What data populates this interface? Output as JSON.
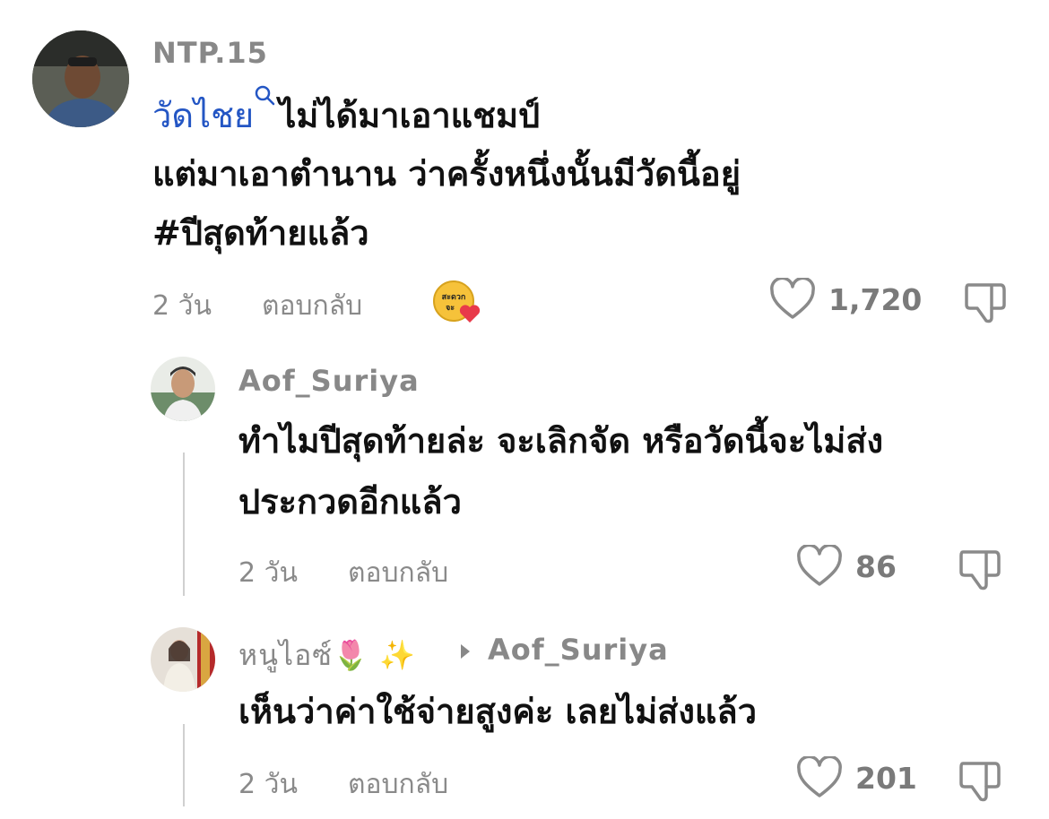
{
  "comments": [
    {
      "username": "NTP.15",
      "link_text": "วัดไชย",
      "line1_rest": "ไม่ได้มาเอาแชมป์",
      "line2": "แต่มาเอาตำนาน ว่าครั้งหนึ่งนั้นมีวัดนี้อยู่",
      "line3": "#ปีสุดท้ายแล้ว",
      "time": "2 วัน",
      "reply_label": "ตอบกลับ",
      "likes": "1,720"
    },
    {
      "username": "Aof_Suriya",
      "line1": "ทำไมปีสุดท้ายล่ะ จะเลิกจัด หรือวัดนี้จะไม่ส่ง",
      "line2": "ประกวดอีกแล้ว",
      "time": "2 วัน",
      "reply_label": "ตอบกลับ",
      "likes": "86"
    },
    {
      "username": "หนูไอซ์🌷 ✨",
      "reply_to": "Aof_Suriya",
      "line1": "เห็นว่าค่าใช้จ่ายสูงค่ะ เลยไม่ส่งแล้ว",
      "time": "2 วัน",
      "reply_label": "ตอบกลับ",
      "likes": "201"
    }
  ],
  "icons": {
    "heart": "heart-outline-icon",
    "dislike": "thumbs-down-icon",
    "search": "search-icon",
    "creator_badge": "creator-liked-badge"
  },
  "badge_text": "สะดวก จะ..."
}
